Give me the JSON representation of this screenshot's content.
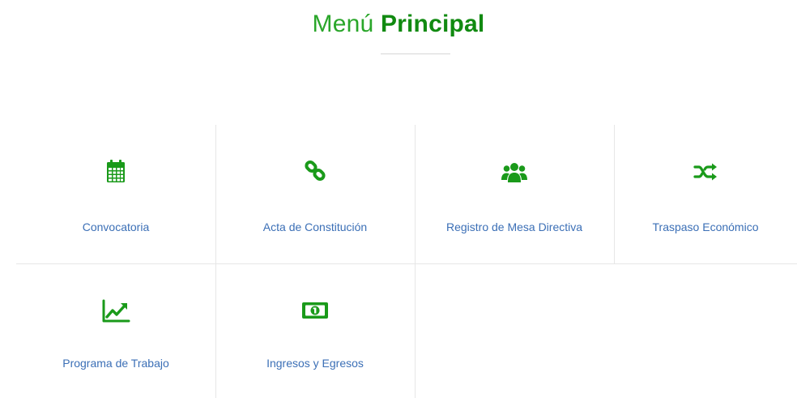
{
  "header": {
    "title_light": "Menú",
    "title_bold": "Principal"
  },
  "menu": {
    "items": [
      {
        "label": "Convocatoria",
        "icon": "calendar-icon"
      },
      {
        "label": "Acta de Constitución",
        "icon": "link-icon"
      },
      {
        "label": "Registro de Mesa Directiva",
        "icon": "users-icon"
      },
      {
        "label": "Traspaso Económico",
        "icon": "shuffle-icon"
      },
      {
        "label": "Programa de Trabajo",
        "icon": "line-chart-icon"
      },
      {
        "label": "Ingresos y Egresos",
        "icon": "money-icon"
      }
    ]
  },
  "colors": {
    "accent": "#1a9a1a",
    "link": "#3b6fb6",
    "grid_line": "#e6e6e6"
  }
}
